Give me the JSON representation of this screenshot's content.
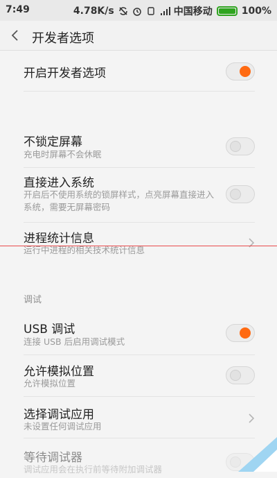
{
  "status": {
    "time": "7:49",
    "speed": "4.78K/s",
    "carrier": "中国移动",
    "battery": "100%"
  },
  "header": {
    "title": "开发者选项"
  },
  "rows": {
    "dev_enable": {
      "label": "开启开发者选项",
      "enabled": true
    },
    "no_lock": {
      "label": "不锁定屏幕",
      "sub": "充电时屏幕不会休眠",
      "enabled": false
    },
    "direct_enter": {
      "label": "直接进入系统",
      "sub": "开启后不使用系统的锁屏样式，点亮屏幕直接进入系统，需要无屏幕密码",
      "enabled": false
    },
    "process_stats": {
      "label": "进程统计信息",
      "sub": "运行中进程的相关技术统计信息"
    },
    "debug_header": "调试",
    "usb_debug": {
      "label": "USB 调试",
      "sub": "连接 USB 后启用调试模式",
      "enabled": true
    },
    "mock_location": {
      "label": "允许模拟位置",
      "sub": "允许模拟位置",
      "enabled": false
    },
    "select_debug_app": {
      "label": "选择调试应用",
      "sub": "未设置任何调试应用"
    },
    "wait_debugger": {
      "label": "等待调试器",
      "sub": "调试应用会在执行前等待附加调试器",
      "enabled": false
    }
  },
  "colors": {
    "accent": "#ff6a12",
    "battery": "#2fa41f",
    "overlay_line": "#e8494b"
  }
}
